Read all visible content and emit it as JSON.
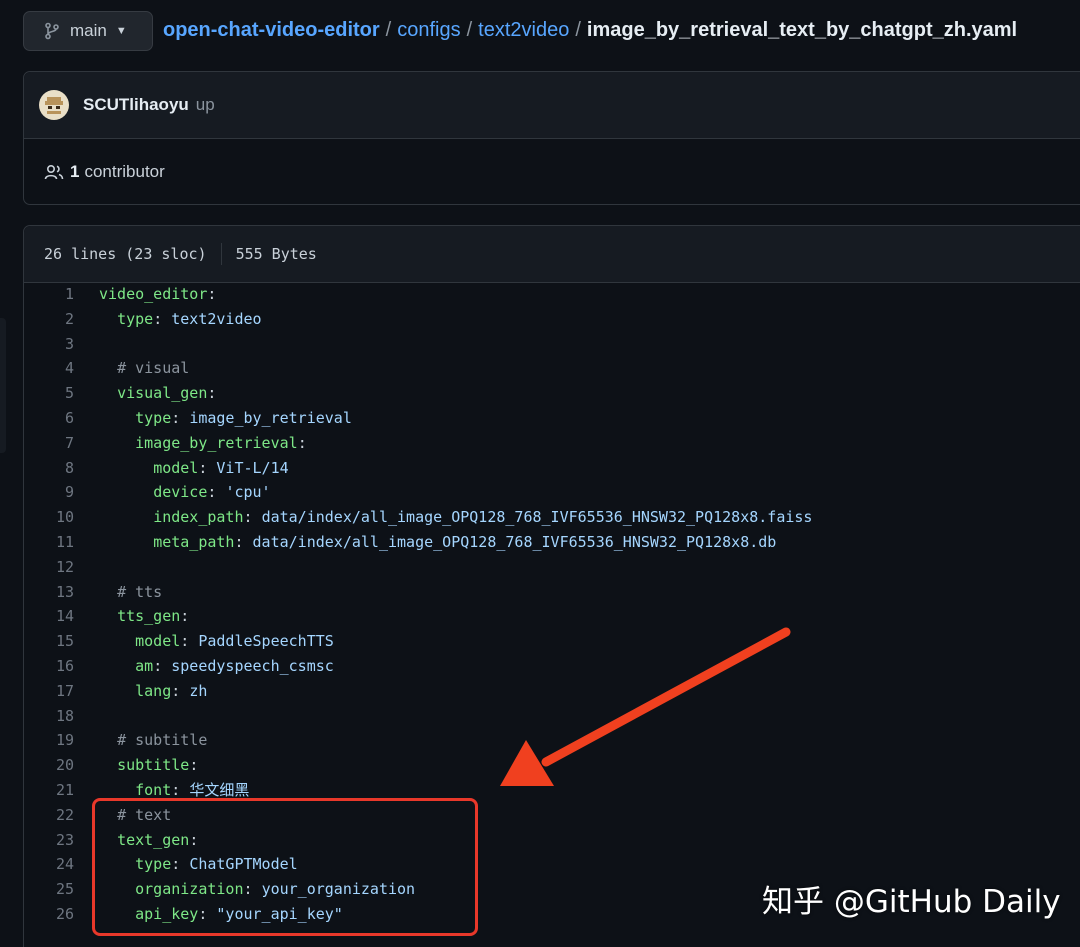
{
  "branch": {
    "label": "main"
  },
  "breadcrumb": {
    "repo": "open-chat-video-editor",
    "sep1": "/",
    "folder1": "configs",
    "sep2": "/",
    "folder2": "text2video",
    "sep3": "/",
    "file": "image_by_retrieval_text_by_chatgpt_zh.yaml"
  },
  "commit": {
    "author": "SCUTlihaoyu",
    "message": "up"
  },
  "contributors": {
    "count": "1",
    "label": "contributor"
  },
  "file_info": {
    "lines": "26 lines (23 sloc)",
    "size": "555 Bytes"
  },
  "code_lines": [
    {
      "n": "1",
      "indent": "",
      "key": "video_editor",
      "value": "",
      "comment": ""
    },
    {
      "n": "2",
      "indent": "  ",
      "key": "type",
      "value": "text2video",
      "comment": ""
    },
    {
      "n": "3",
      "indent": "",
      "key": "",
      "value": "",
      "comment": ""
    },
    {
      "n": "4",
      "indent": "  ",
      "key": "",
      "value": "",
      "comment": "# visual"
    },
    {
      "n": "5",
      "indent": "  ",
      "key": "visual_gen",
      "value": "",
      "comment": ""
    },
    {
      "n": "6",
      "indent": "    ",
      "key": "type",
      "value": "image_by_retrieval",
      "comment": ""
    },
    {
      "n": "7",
      "indent": "    ",
      "key": "image_by_retrieval",
      "value": "",
      "comment": ""
    },
    {
      "n": "8",
      "indent": "      ",
      "key": "model",
      "value": "ViT-L/14",
      "comment": ""
    },
    {
      "n": "9",
      "indent": "      ",
      "key": "device",
      "value": "'cpu'",
      "comment": ""
    },
    {
      "n": "10",
      "indent": "      ",
      "key": "index_path",
      "value": "data/index/all_image_OPQ128_768_IVF65536_HNSW32_PQ128x8.faiss",
      "comment": ""
    },
    {
      "n": "11",
      "indent": "      ",
      "key": "meta_path",
      "value": "data/index/all_image_OPQ128_768_IVF65536_HNSW32_PQ128x8.db",
      "comment": ""
    },
    {
      "n": "12",
      "indent": "",
      "key": "",
      "value": "",
      "comment": ""
    },
    {
      "n": "13",
      "indent": "  ",
      "key": "",
      "value": "",
      "comment": "# tts"
    },
    {
      "n": "14",
      "indent": "  ",
      "key": "tts_gen",
      "value": "",
      "comment": ""
    },
    {
      "n": "15",
      "indent": "    ",
      "key": "model",
      "value": "PaddleSpeechTTS",
      "comment": ""
    },
    {
      "n": "16",
      "indent": "    ",
      "key": "am",
      "value": "speedyspeech_csmsc",
      "comment": ""
    },
    {
      "n": "17",
      "indent": "    ",
      "key": "lang",
      "value": "zh",
      "comment": ""
    },
    {
      "n": "18",
      "indent": "",
      "key": "",
      "value": "",
      "comment": ""
    },
    {
      "n": "19",
      "indent": "  ",
      "key": "",
      "value": "",
      "comment": "# subtitle"
    },
    {
      "n": "20",
      "indent": "  ",
      "key": "subtitle",
      "value": "",
      "comment": ""
    },
    {
      "n": "21",
      "indent": "    ",
      "key": "font",
      "value": "华文细黑",
      "comment": ""
    },
    {
      "n": "22",
      "indent": "  ",
      "key": "",
      "value": "",
      "comment": "# text"
    },
    {
      "n": "23",
      "indent": "  ",
      "key": "text_gen",
      "value": "",
      "comment": ""
    },
    {
      "n": "24",
      "indent": "    ",
      "key": "type",
      "value": "ChatGPTModel",
      "comment": ""
    },
    {
      "n": "25",
      "indent": "    ",
      "key": "organization",
      "value": "your_organization",
      "comment": ""
    },
    {
      "n": "26",
      "indent": "    ",
      "key": "api_key",
      "value": "\"your_api_key\"",
      "comment": ""
    }
  ],
  "watermark": {
    "text": "知乎 @GitHub Daily"
  },
  "colors": {
    "background": "#0d1117",
    "link": "#58a6ff",
    "yaml_key": "#7ee787",
    "yaml_value": "#a5d6ff",
    "comment": "#8b949e",
    "annotation_red": "#e8382a",
    "arrow_orange": "#f0401f"
  },
  "icons": {
    "branch": "git-branch-icon",
    "caret": "caret-down-icon",
    "contributors": "people-icon",
    "avatar": "user-avatar"
  }
}
